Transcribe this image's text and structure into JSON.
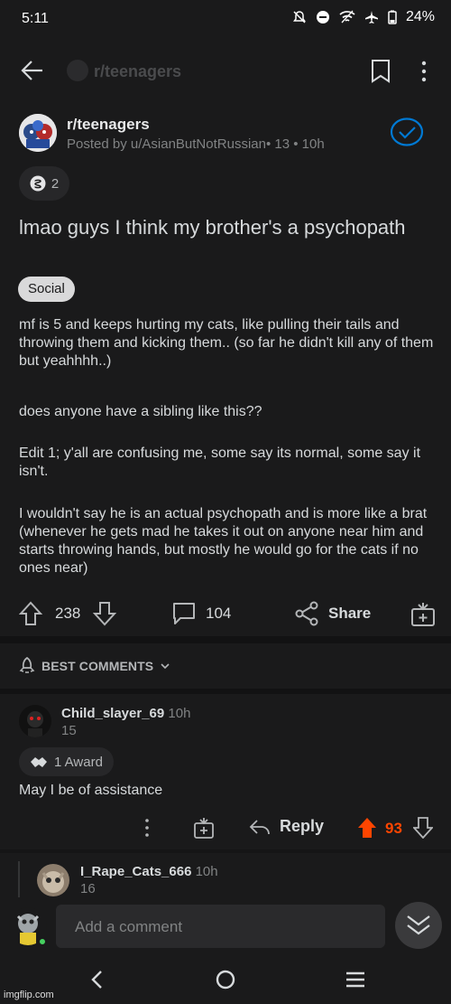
{
  "status": {
    "time": "5:11",
    "battery": "24%"
  },
  "topbar": {
    "subreddit": "r/teenagers"
  },
  "post": {
    "subreddit": "r/teenagers",
    "posted_by": "Posted by u/AsianButNotRussian• 13 • 10h",
    "award_count": "2",
    "title": "lmao guys I think my brother's a psychopath",
    "flair": "Social",
    "paragraphs": [
      "mf is 5 and keeps hurting my cats, like pulling their tails and throwing them and kicking them.. (so far he didn't kill any of them but yeahhhh..)",
      "does anyone have a sibling like this??",
      "Edit 1; y'all are confusing me, some say its normal, some say it isn't.",
      "I wouldn't say he is an actual psychopath and is more like a brat (whenever he gets mad he takes it out on anyone near him and starts throwing hands, but mostly he would go for the cats if no ones near)"
    ],
    "upvotes": "238",
    "comments": "104",
    "share_label": "Share"
  },
  "comments_header": {
    "label": "BEST COMMENTS"
  },
  "comment1": {
    "user": "Child_slayer_69",
    "time": "10h",
    "score": "15",
    "award": "1 Award",
    "text": "May I be of assistance",
    "reply_label": "Reply",
    "votes": "93"
  },
  "comment2": {
    "user": "I_Rape_Cats_666",
    "time": "10h",
    "score": "16"
  },
  "compose": {
    "placeholder": "Add a comment"
  },
  "watermark": "imgflip.com",
  "colors": {
    "background": "#1a1a1b",
    "upvote_orange": "#ff4500",
    "accent_blue": "#0079d3",
    "online_green": "#46d160"
  }
}
